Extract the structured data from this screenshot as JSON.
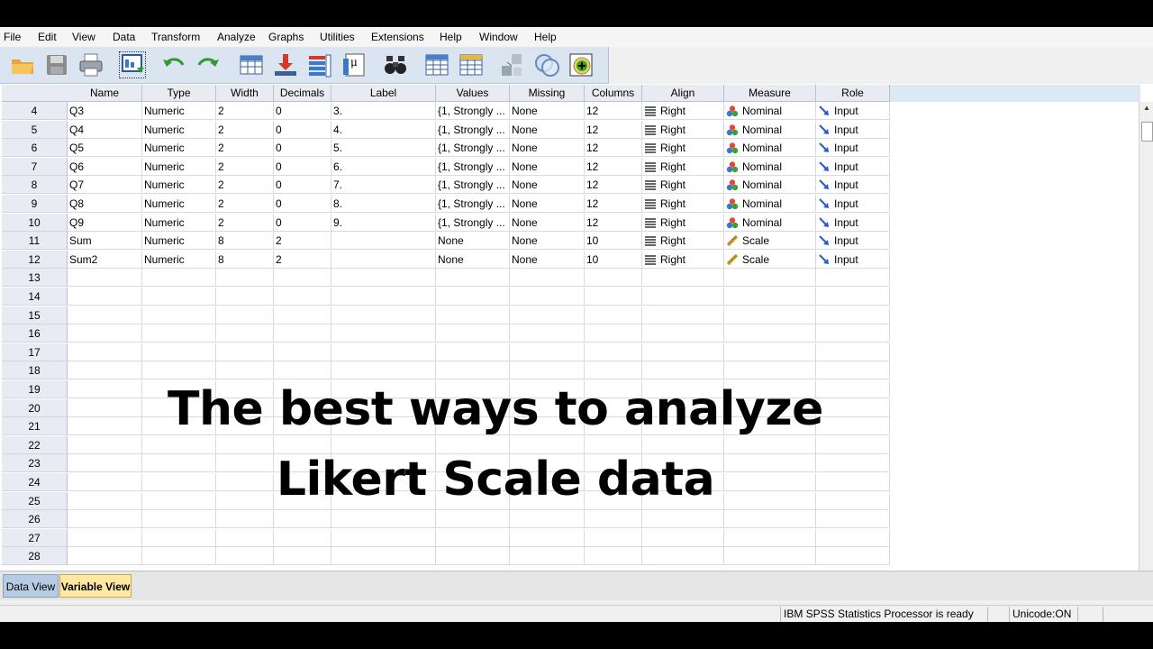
{
  "menu": [
    "File",
    "Edit",
    "View",
    "Data",
    "Transform",
    "Analyze",
    "Graphs",
    "Utilities",
    "Extensions",
    "Help",
    "Window",
    "Help"
  ],
  "toolbar": [
    "open-folder-icon",
    "save-icon",
    "print-icon",
    "recall-dialog-icon",
    "undo-icon",
    "redo-icon",
    "goto-case-icon",
    "goto-variable-icon",
    "variables-icon",
    "run-descriptives-icon",
    "find-icon",
    "insert-cases-icon",
    "insert-variable-icon",
    "split-file-icon",
    "weight-cases-icon",
    "select-cases-icon"
  ],
  "columns": [
    "Name",
    "Type",
    "Width",
    "Decimals",
    "Label",
    "Values",
    "Missing",
    "Columns",
    "Align",
    "Measure",
    "Role"
  ],
  "rows": [
    {
      "num": "4",
      "name": "Q3",
      "type": "Numeric",
      "width": "2",
      "decimals": "0",
      "label": "3.",
      "values": "{1, Strongly ...",
      "missing": "None",
      "columns": "12",
      "align": "Right",
      "measure": "Nominal",
      "role": "Input"
    },
    {
      "num": "5",
      "name": "Q4",
      "type": "Numeric",
      "width": "2",
      "decimals": "0",
      "label": "4.",
      "values": "{1, Strongly ...",
      "missing": "None",
      "columns": "12",
      "align": "Right",
      "measure": "Nominal",
      "role": "Input"
    },
    {
      "num": "6",
      "name": "Q5",
      "type": "Numeric",
      "width": "2",
      "decimals": "0",
      "label": "5.",
      "values": "{1, Strongly ...",
      "missing": "None",
      "columns": "12",
      "align": "Right",
      "measure": "Nominal",
      "role": "Input"
    },
    {
      "num": "7",
      "name": "Q6",
      "type": "Numeric",
      "width": "2",
      "decimals": "0",
      "label": "6.",
      "values": "{1, Strongly ...",
      "missing": "None",
      "columns": "12",
      "align": "Right",
      "measure": "Nominal",
      "role": "Input"
    },
    {
      "num": "8",
      "name": "Q7",
      "type": "Numeric",
      "width": "2",
      "decimals": "0",
      "label": "7.",
      "values": "{1, Strongly ...",
      "missing": "None",
      "columns": "12",
      "align": "Right",
      "measure": "Nominal",
      "role": "Input"
    },
    {
      "num": "9",
      "name": "Q8",
      "type": "Numeric",
      "width": "2",
      "decimals": "0",
      "label": "8.",
      "values": "{1, Strongly ...",
      "missing": "None",
      "columns": "12",
      "align": "Right",
      "measure": "Nominal",
      "role": "Input"
    },
    {
      "num": "10",
      "name": "Q9",
      "type": "Numeric",
      "width": "2",
      "decimals": "0",
      "label": "9.",
      "values": "{1, Strongly ...",
      "missing": "None",
      "columns": "12",
      "align": "Right",
      "measure": "Nominal",
      "role": "Input"
    },
    {
      "num": "11",
      "name": "Sum",
      "type": "Numeric",
      "width": "8",
      "decimals": "2",
      "label": "",
      "values": "None",
      "missing": "None",
      "columns": "10",
      "align": "Right",
      "measure": "Scale",
      "role": "Input"
    },
    {
      "num": "12",
      "name": "Sum2",
      "type": "Numeric",
      "width": "8",
      "decimals": "2",
      "label": "",
      "values": "None",
      "missing": "None",
      "columns": "10",
      "align": "Right",
      "measure": "Scale",
      "role": "Input"
    }
  ],
  "empty_rows": [
    "13",
    "14",
    "15",
    "16",
    "17",
    "18",
    "19",
    "20",
    "21",
    "22",
    "23",
    "24",
    "25",
    "26",
    "27",
    "28"
  ],
  "overlay": {
    "line1": "The best ways to analyze",
    "line2": "Likert Scale data"
  },
  "tabs": {
    "data_view": "Data View",
    "variable_view": "Variable View"
  },
  "status": {
    "processor": "IBM SPSS Statistics Processor is ready",
    "unicode": "Unicode:ON"
  }
}
